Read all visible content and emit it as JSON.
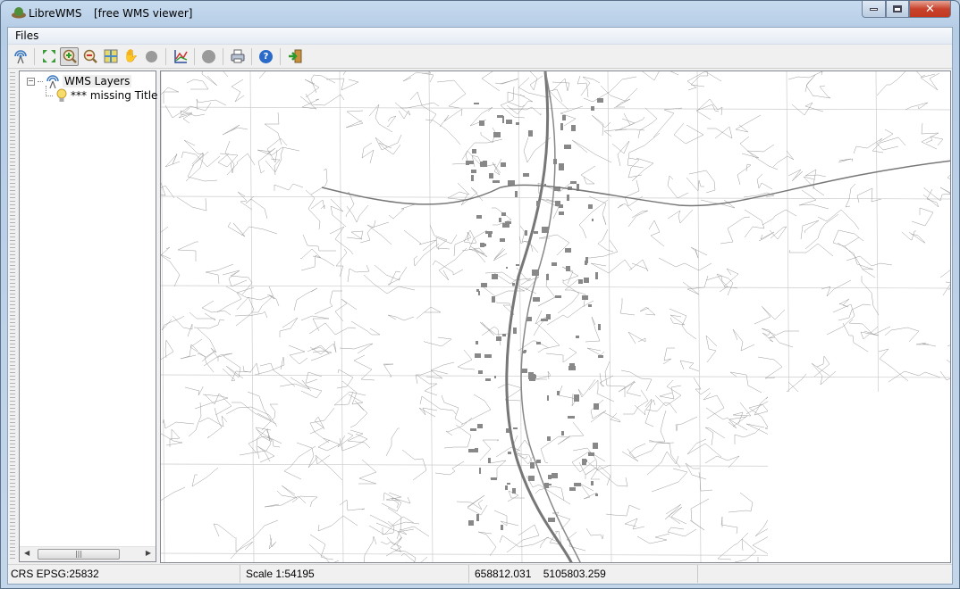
{
  "window": {
    "title": "LibreWMS",
    "subtitle": "[free WMS viewer]"
  },
  "menu": {
    "files": "Files"
  },
  "toolbar": [
    "wms-connect",
    "zoom-full-extent",
    "zoom-in",
    "zoom-out",
    "zoom-layer",
    "pan",
    "stop",
    "legend",
    "record",
    "print",
    "help",
    "exit"
  ],
  "tree": {
    "root": "WMS Layers",
    "child": "*** missing Title"
  },
  "status": {
    "crs": "CRS EPSG:25832",
    "scale": "Scale 1:54195",
    "x": "658812.031",
    "y": "5105803.259"
  },
  "colors": {
    "frame": "#b9cde3",
    "close": "#c8432c"
  }
}
